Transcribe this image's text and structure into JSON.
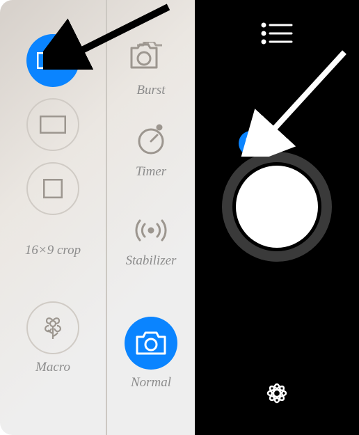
{
  "options": {
    "aspect": {
      "wide": {
        "selected": true
      },
      "standard": {
        "selected": false
      },
      "square": {
        "selected": false
      },
      "crop_label": "16×9 crop"
    },
    "macro": {
      "label": "Macro"
    },
    "burst": {
      "label": "Burst"
    },
    "timer": {
      "label": "Timer"
    },
    "stabilizer": {
      "label": "Stabilizer"
    },
    "normal": {
      "label": "Normal",
      "selected": true
    }
  },
  "colors": {
    "accent": "#0a84ff"
  }
}
